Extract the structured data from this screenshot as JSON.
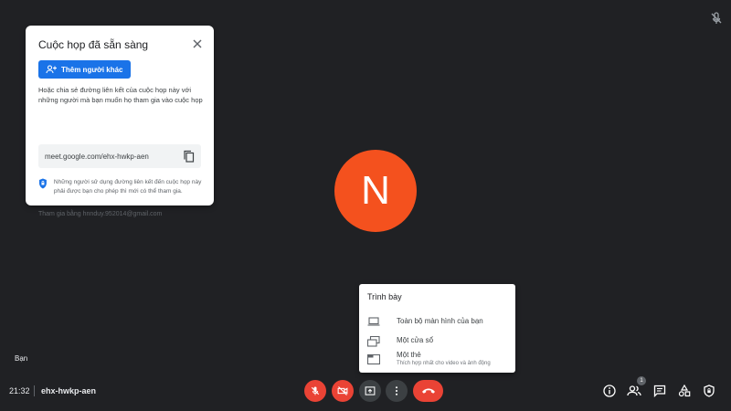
{
  "card": {
    "title": "Cuộc họp đã sẵn sàng",
    "add_button_label": "Thêm người khác",
    "description": "Hoặc chia sẻ đường liên kết của cuộc họp này với những người mà bạn muốn họ tham gia vào cuộc họp",
    "link": "meet.google.com/ehx-hwkp-aen",
    "security_note": "Những người sử dụng đường liên kết đến cuộc họp này phải được bạn cho phép thì mới có thể tham gia.",
    "joined_as": "Tham gia bằng hnnduy.952014@gmail.com"
  },
  "avatar": {
    "initial": "N",
    "color": "#f4511e"
  },
  "present_menu": {
    "title": "Trình bày",
    "items": [
      {
        "label": "Toàn bộ màn hình của bạn",
        "icon": "laptop-icon"
      },
      {
        "label": "Một cửa sổ",
        "icon": "window-icon"
      },
      {
        "label": "Một thẻ",
        "sublabel": "Thích hợp nhất cho video và ảnh động",
        "icon": "tab-icon"
      }
    ]
  },
  "self_label": "Bạn",
  "bottom_bar": {
    "time": "21:32",
    "meeting_code": "ehx-hwkp-aen",
    "participants_count": "1",
    "accent_red": "#ea4335"
  }
}
